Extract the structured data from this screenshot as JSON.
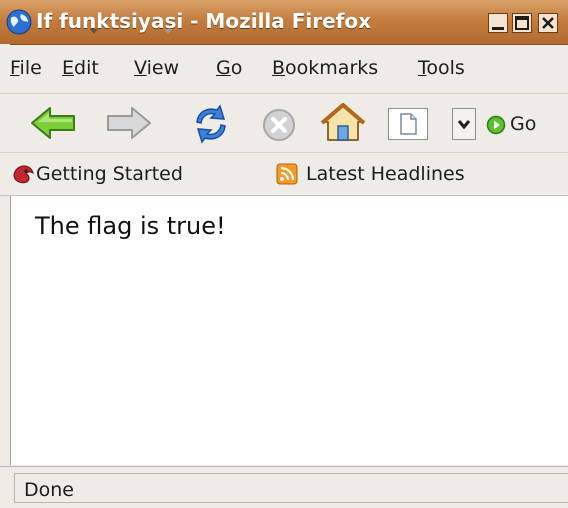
{
  "window": {
    "title": "If funktsiyasi - Mozilla Firefox"
  },
  "menubar": {
    "items": [
      {
        "label": "File",
        "accel": "F",
        "rest": "ile"
      },
      {
        "label": "Edit",
        "accel": "E",
        "rest": "dit"
      },
      {
        "label": "View",
        "accel": "V",
        "rest": "iew"
      },
      {
        "label": "Go",
        "accel": "G",
        "rest": "o"
      },
      {
        "label": "Bookmarks",
        "accel": "B",
        "rest": "ookmarks"
      },
      {
        "label": "Tools",
        "accel": "T",
        "rest": "ools"
      }
    ]
  },
  "toolbar": {
    "icons": [
      "back-arrow-icon",
      "forward-arrow-icon",
      "reload-icon",
      "stop-icon",
      "home-icon",
      "page-icon",
      "dropdown-arrow-icon",
      "go-icon"
    ],
    "go_label": "Go"
  },
  "bookmarks": {
    "items": [
      {
        "label": "Getting Started",
        "icon": "firefox-bookmark-icon"
      },
      {
        "label": "Latest Headlines",
        "icon": "rss-feed-icon"
      }
    ]
  },
  "content": {
    "text": "The flag is true!"
  },
  "status": {
    "text": "Done"
  },
  "colors": {
    "titlebar": "#c47d3f",
    "chrome": "#efebe7",
    "content_bg": "#ffffff"
  }
}
